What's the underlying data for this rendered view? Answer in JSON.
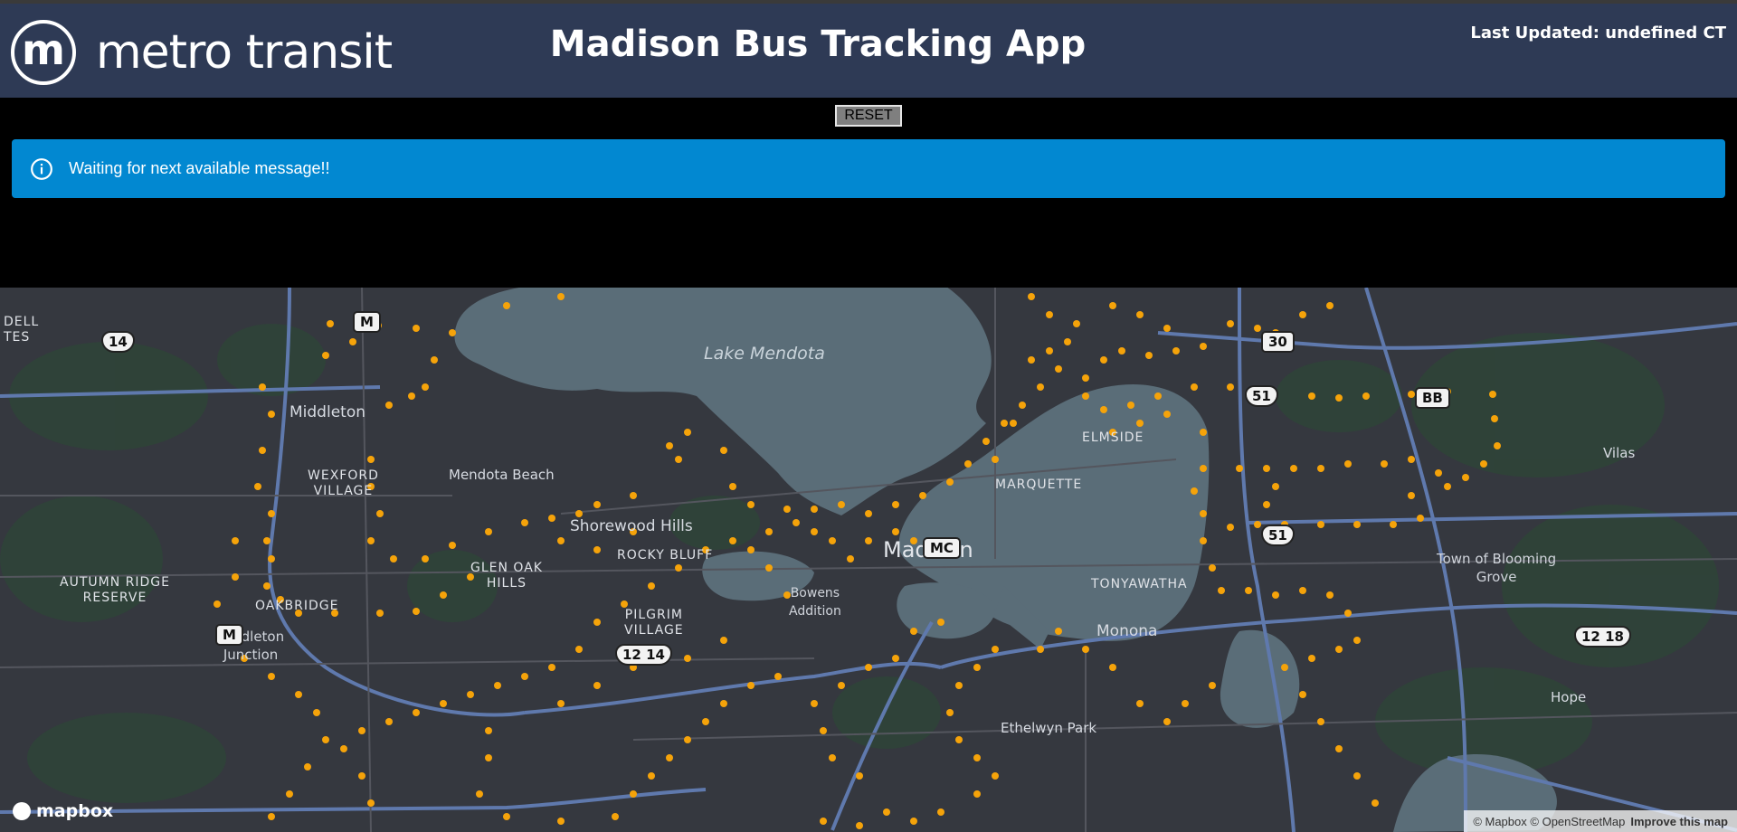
{
  "header": {
    "logo_letter": "m",
    "logo_text": "metro transit",
    "title": "Madison Bus Tracking App",
    "last_updated": "Last Updated: undefined CT"
  },
  "controls": {
    "reset_label": "RESET"
  },
  "alert": {
    "message": "Waiting for next available message!!",
    "color": "#0288d1"
  },
  "map": {
    "water_labels": {
      "lake_mendota": "Lake Mendota",
      "monona": "Monona"
    },
    "city_labels": {
      "middleton": "Middleton",
      "madison": "Madison",
      "shorewood_hills": "Shorewood Hills",
      "mendota_beach": "Mendota Beach",
      "vilas": "Vilas",
      "hope": "Hope",
      "ethelwyn_park": "Ethelwyn Park",
      "middleton_junction": "Middleton\nJunction",
      "town_of_blooming_grove": "Town of Blooming\nGrove",
      "dell": "DELL\nTES"
    },
    "neighborhood_labels": {
      "wexford_village": "WEXFORD\nVILLAGE",
      "autumn_ridge_reserve": "AUTUMN RIDGE\nRESERVE",
      "glen_oak_hills": "GLEN OAK\nHILLS",
      "oakbridge": "OAKBRIDGE",
      "rocky_bluff": "ROCKY BLUFF",
      "pilgrim_village": "PILGRIM\nVILLAGE",
      "marquette": "MARQUETTE",
      "elmside": "ELMSIDE",
      "tonyawatha": "TONYAWATHA",
      "bowens_addition": "Bowens\nAddition"
    },
    "road_shields": {
      "us14": "14",
      "m_top": "M",
      "m_bottom": "M",
      "i30": "30",
      "us51_top": "51",
      "us51_bottom": "51",
      "bb": "BB",
      "mc": "MC",
      "us12_14": "12 14",
      "us12_18": "12 18"
    },
    "marker_color": "#f5a30a",
    "attribution": {
      "mapbox": "© Mapbox",
      "osm": "© OpenStreetMap",
      "improve": "Improve this map"
    },
    "mapbox_logo": "mapbox"
  }
}
